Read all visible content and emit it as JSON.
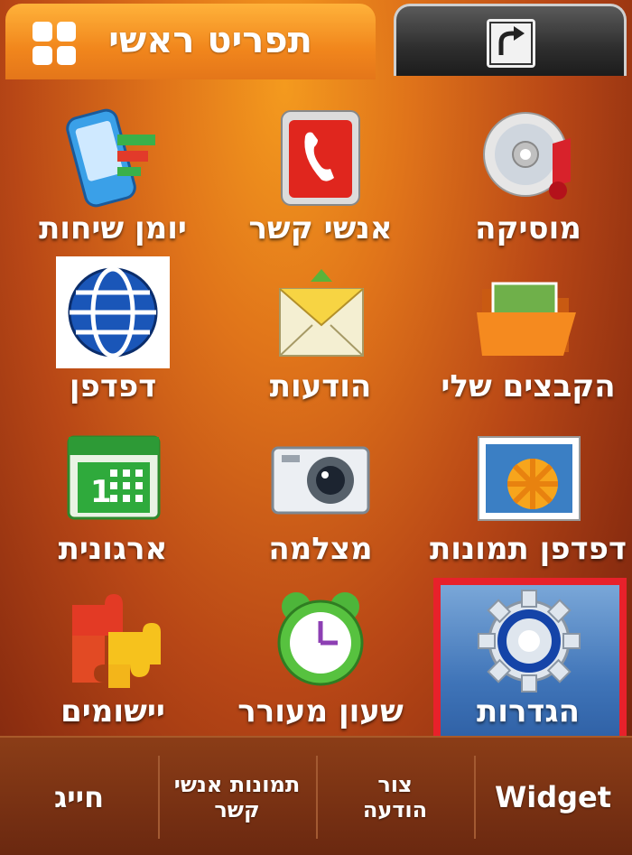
{
  "tabs": {
    "main_title": "תפריט ראשי",
    "side_tab_icon": "shortcut-arrow-icon"
  },
  "apps": [
    {
      "label": "מוסיקה",
      "icon": "music-cd-icon"
    },
    {
      "label": "אנשי קשר",
      "icon": "contacts-phone-icon"
    },
    {
      "label": "יומן שיחות",
      "icon": "call-log-icon"
    },
    {
      "label": "הקבצים שלי",
      "icon": "folder-icon"
    },
    {
      "label": "הודעות",
      "icon": "envelope-icon"
    },
    {
      "label": "דפדפן",
      "icon": "globe-icon"
    },
    {
      "label": "דפדפן תמונות",
      "icon": "image-viewer-icon"
    },
    {
      "label": "מצלמה",
      "icon": "camera-icon"
    },
    {
      "label": "ארגונית",
      "icon": "calendar-icon"
    },
    {
      "label": "הגדרות",
      "icon": "settings-gear-icon"
    },
    {
      "label": "שעון מעורר",
      "icon": "alarm-clock-icon"
    },
    {
      "label": "יישומים",
      "icon": "puzzle-icon"
    }
  ],
  "softkeys": {
    "widget": "Widget",
    "create_message": "צור הודעה",
    "contact_photos": "תמונות אנשי קשר",
    "dial": "חייג"
  },
  "colors": {
    "selection_border": "#e8212b",
    "accent_orange": "#f1861c"
  }
}
